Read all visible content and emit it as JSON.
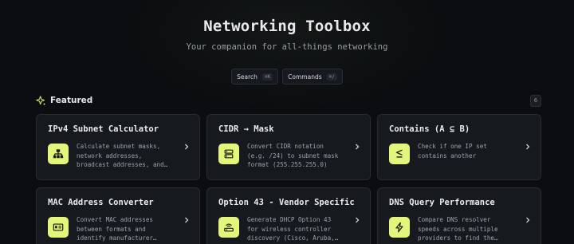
{
  "header": {
    "title": "Networking Toolbox",
    "subtitle": "Your companion for all-things networking"
  },
  "actions": [
    {
      "label": "Search",
      "shortcut": "⌘K"
    },
    {
      "label": "Commands",
      "shortcut": "⌘/"
    }
  ],
  "featured": {
    "title": "Featured",
    "count": "6",
    "cards": [
      {
        "title": "IPv4 Subnet Calculator",
        "description": "Calculate subnet masks, network addresses, broadcast addresses, and…",
        "icon": "network-tree-icon"
      },
      {
        "title": "CIDR → Mask",
        "description": "Convert CIDR notation (e.g. /24) to subnet mask format (255.255.255.0)",
        "icon": "server-icon"
      },
      {
        "title": "Contains (A ⊆ B)",
        "description": "Check if one IP set contains another",
        "icon": "subset-icon"
      },
      {
        "title": "MAC Address Converter",
        "description": "Convert MAC addresses between formats and identify manufacturer…",
        "icon": "id-card-icon"
      },
      {
        "title": "Option 43 - Vendor Specific",
        "description": "Generate DHCP Option 43 for wireless controller discovery (Cisco, Aruba,…",
        "icon": "router-icon"
      },
      {
        "title": "DNS Query Performance",
        "description": "Compare DNS resolver speeds across multiple providers to find the…",
        "icon": "bolt-icon"
      }
    ]
  },
  "colors": {
    "background": "#0b0d10",
    "card": "#16191d",
    "accent": "#e3f57a",
    "sparkle": "#d7ee5a"
  }
}
